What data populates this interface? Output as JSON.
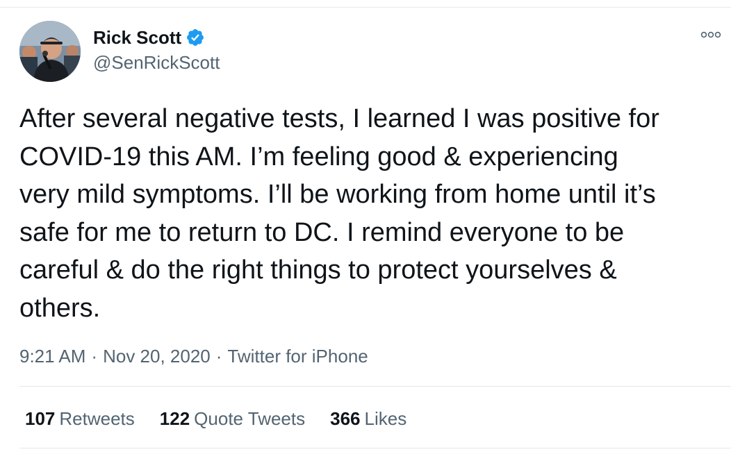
{
  "tweet": {
    "author": {
      "display_name": "Rick Scott",
      "handle": "@SenRickScott",
      "verified": true,
      "avatar_icon": "profile-photo",
      "verified_icon": "verified-badge-icon",
      "verified_color": "#1d9bf0"
    },
    "more_icon": "more-options-icon",
    "text": "After several negative tests, I learned I was positive for\nCOVID-19 this AM. I’m feeling good & experiencing\nvery mild symptoms. I’ll be working from home until it’s\nsafe for me to return to DC. I remind everyone to be\ncareful & do the right things to protect yourselves &\nothers.",
    "time": "9:21 AM",
    "separator": "·",
    "date": "Nov 20, 2020",
    "source": "Twitter for iPhone",
    "stats": {
      "retweets": {
        "count": "107",
        "label": "Retweets"
      },
      "quote_tweets": {
        "count": "122",
        "label": "Quote Tweets"
      },
      "likes": {
        "count": "366",
        "label": "Likes"
      }
    }
  }
}
